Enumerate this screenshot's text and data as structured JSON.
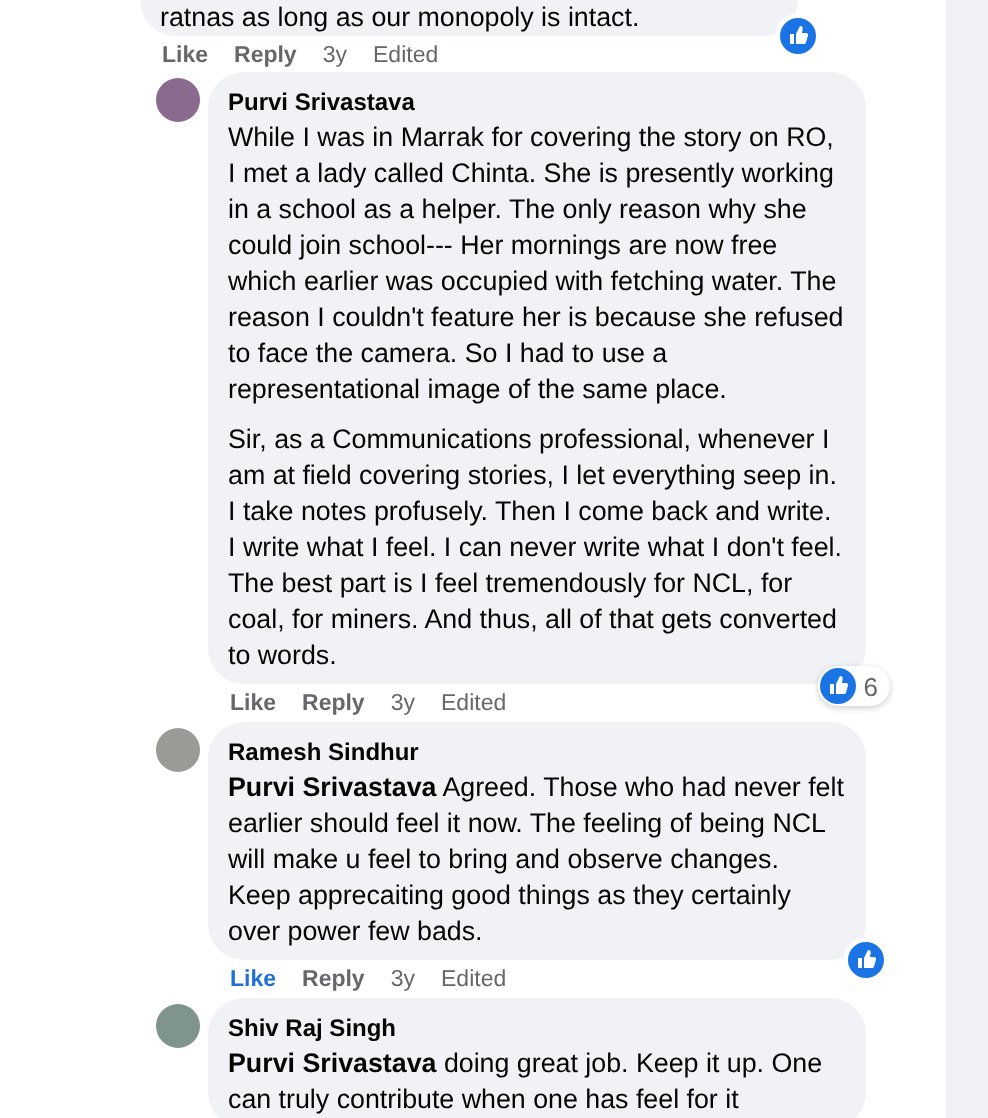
{
  "comments": [
    {
      "has_avatar": false,
      "text": "ratnas as long as our monopoly is intact.",
      "actions": {
        "like": "Like",
        "liked": false,
        "reply": "Reply",
        "age": "3y",
        "edited": "Edited"
      },
      "has_reactions": true,
      "children": [
        {
          "has_avatar": true,
          "author": "Purvi Srivastava",
          "paragraphs": [
            "While I was in Marrak for covering the story on RO, I met a lady called Chinta. She is presently working in a school as a helper. The only reason why she could join school--- Her mornings are now free which earlier was occupied with fetching water. The reason I couldn't feature her is because she refused to face the camera. So I had to use a representational image of the same place.",
            "Sir, as a Communications professional, whenever I am at field covering stories, I let everything seep in. I take notes profusely. Then I come back and write. I write what I feel. I can never write what I don't feel. The best part is I feel tremendously for NCL, for coal, for miners. And thus, all of that gets converted to words."
          ],
          "actions": {
            "like": "Like",
            "liked": false,
            "reply": "Reply",
            "age": "3y",
            "edited": "Edited"
          },
          "has_reactions": true,
          "reaction_count": "6"
        },
        {
          "has_avatar": true,
          "author": "Ramesh Sindhur",
          "paragraphs": [
            "**Purvi Srivastava** Agreed. Those who had never felt earlier should feel it now. The feeling of being NCL will make u feel to bring and observe changes. Keep apprecaiting good things as they certainly over power few bads."
          ],
          "actions": {
            "like": "Like",
            "liked": true,
            "reply": "Reply",
            "age": "3y",
            "edited": "Edited"
          },
          "has_reactions": true
        },
        {
          "has_avatar": true,
          "author": "Shiv Raj Singh",
          "paragraphs": [
            "**Purvi Srivastava** doing great job. Keep it up. One can truly contribute when one has feel for it"
          ],
          "has_reactions": false
        }
      ]
    }
  ]
}
